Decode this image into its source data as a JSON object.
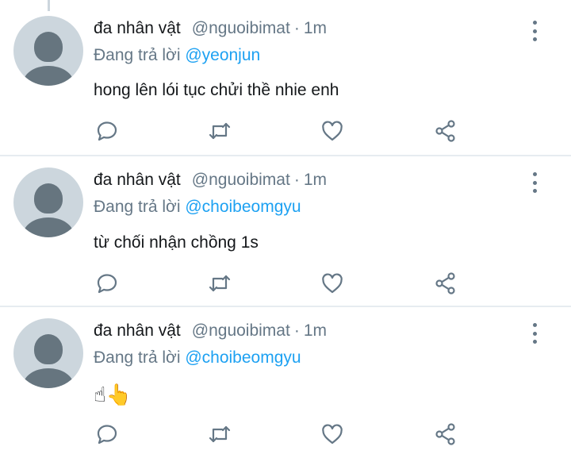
{
  "tweets": [
    {
      "name": "đa nhân vật",
      "handle": "@nguoibimat",
      "separator": "·",
      "time": "1m",
      "reply_prefix": "Đang trả lời",
      "mention": "@yeonjun",
      "text": "hong lên lói tục chửi thề nhie enh"
    },
    {
      "name": "đa nhân vật",
      "handle": "@nguoibimat",
      "separator": "·",
      "time": "1m",
      "reply_prefix": "Đang trả lời",
      "mention": "@choibeomgyu",
      "text": "từ chối nhận chồng 1s"
    },
    {
      "name": "đa nhân vật",
      "handle": "@nguoibimat",
      "separator": "·",
      "time": "1m",
      "reply_prefix": "Đang trả lời",
      "mention": "@choibeomgyu",
      "text": "☝👆"
    }
  ],
  "icons": {
    "reply": "reply-icon",
    "retweet": "retweet-icon",
    "like": "heart-icon",
    "share": "share-icon",
    "more": "more-vertical-icon"
  },
  "colors": {
    "text": "#14171a",
    "secondary": "#657786",
    "link": "#1da1f2",
    "avatar_bg": "#ccd6dd",
    "divider": "#e6ecf0"
  }
}
